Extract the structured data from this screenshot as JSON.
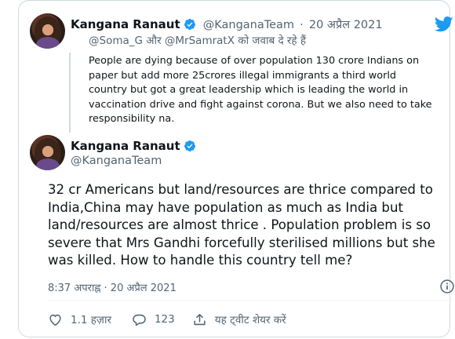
{
  "quoted_tweet": {
    "author_name": "Kangana Ranaut",
    "handle": "@KanganaTeam",
    "separator": "·",
    "date": "20 अप्रैल 2021",
    "reply_to": {
      "user1": "@Soma_G",
      "conjunction": "और",
      "user2": "@MrSamratX",
      "suffix": "को जवाब दे रहे हैं"
    },
    "text": "People are dying because of over population 130 crore Indians on paper but add more 25crores illegal immigrants a third world country but got a great leadership which is leading the world in vaccination drive and fight against corona. But we also need to take responsibility na."
  },
  "main_tweet": {
    "author_name": "Kangana Ranaut",
    "handle": "@KanganaTeam",
    "text": "32 cr Americans but land/resources are thrice compared to India,China may have population as much as India but land/resources are almost thrice . Population problem is so severe that Mrs Gandhi forcefully sterilised millions but she was killed. How to handle this country tell me?",
    "timestamp": "8:37 अपराह्न · 20 अप्रैल 2021"
  },
  "actions": {
    "likes": "1.1 हज़ार",
    "replies": "123",
    "share_label": "यह ट्वीट शेयर करें"
  },
  "icons": {
    "brand": "twitter-bird-icon",
    "verified": "verified-badge-icon",
    "info": "info-icon",
    "like": "heart-icon",
    "reply": "reply-bubble-icon",
    "share": "share-icon"
  },
  "colors": {
    "twitter_blue": "#1d9bf0",
    "text": "#0f1419",
    "muted": "#536471",
    "border": "#cfd9de"
  }
}
